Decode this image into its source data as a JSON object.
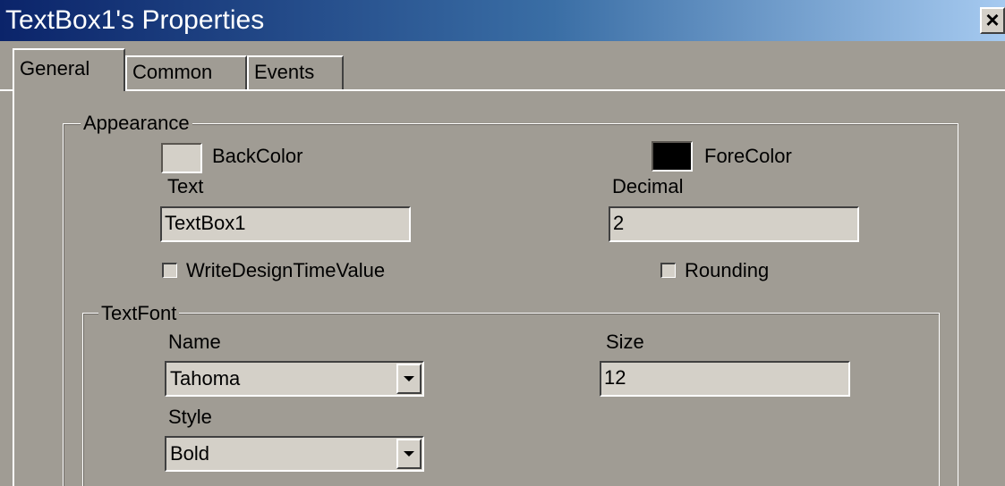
{
  "window": {
    "title": "TextBox1's Properties",
    "close_label": "×"
  },
  "tabs": [
    {
      "label": "General",
      "selected": true
    },
    {
      "label": "Common",
      "selected": false
    },
    {
      "label": "Events",
      "selected": false
    }
  ],
  "appearance": {
    "group_label": "Appearance",
    "backcolor_label": "BackColor",
    "backcolor_value": "#d4d0c8",
    "forecolor_label": "ForeColor",
    "forecolor_value": "#000000",
    "text_label": "Text",
    "text_value": "TextBox1",
    "decimal_label": "Decimal",
    "decimal_value": "2",
    "write_design_label": "WriteDesignTimeValue",
    "write_design_checked": false,
    "rounding_label": "Rounding",
    "rounding_checked": false
  },
  "textfont": {
    "group_label": "TextFont",
    "name_label": "Name",
    "name_value": "Tahoma",
    "size_label": "Size",
    "size_value": "12",
    "style_label": "Style",
    "style_value": "Bold"
  },
  "colors": {
    "titlebar_start": "#0b246a",
    "titlebar_end": "#a6caf0",
    "dialog_background": "#a09c94"
  },
  "icons": {
    "close": "close-icon",
    "dropdown": "chevron-down-icon"
  }
}
